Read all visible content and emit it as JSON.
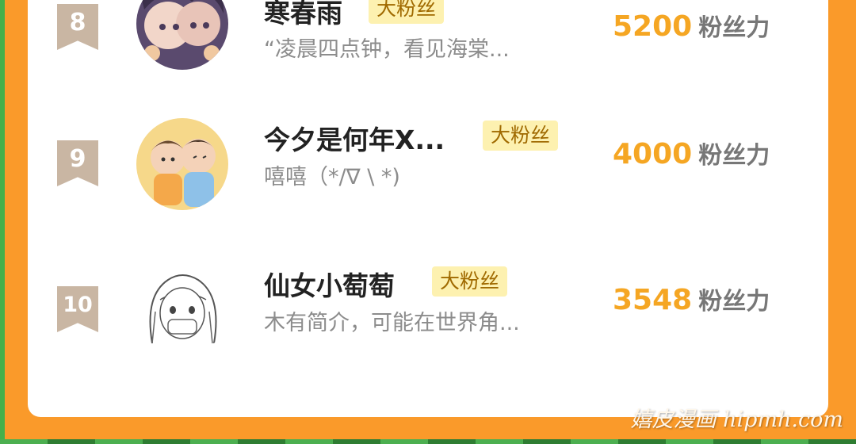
{
  "fans": [
    {
      "rank": "8",
      "name": "寒春雨",
      "badge": "大粉丝",
      "desc": "“凌晨四点钟，看见海棠...",
      "score": "5200",
      "unit": "粉丝力"
    },
    {
      "rank": "9",
      "name": "今夕是何年X...",
      "badge": "大粉丝",
      "desc": "嘻嘻（*/∇ \\ *)",
      "score": "4000",
      "unit": "粉丝力"
    },
    {
      "rank": "10",
      "name": "仙女小萄萄",
      "badge": "大粉丝",
      "desc": "木有简介，可能在世界角...",
      "score": "3548",
      "unit": "粉丝力"
    }
  ],
  "watermark": "嬉皮漫画 hipmh.com",
  "colors": {
    "background": "#fa9a2a",
    "score": "#f5a623",
    "badge_bg": "#fdf1b0",
    "rank_ribbon": "#c9b6a3"
  }
}
